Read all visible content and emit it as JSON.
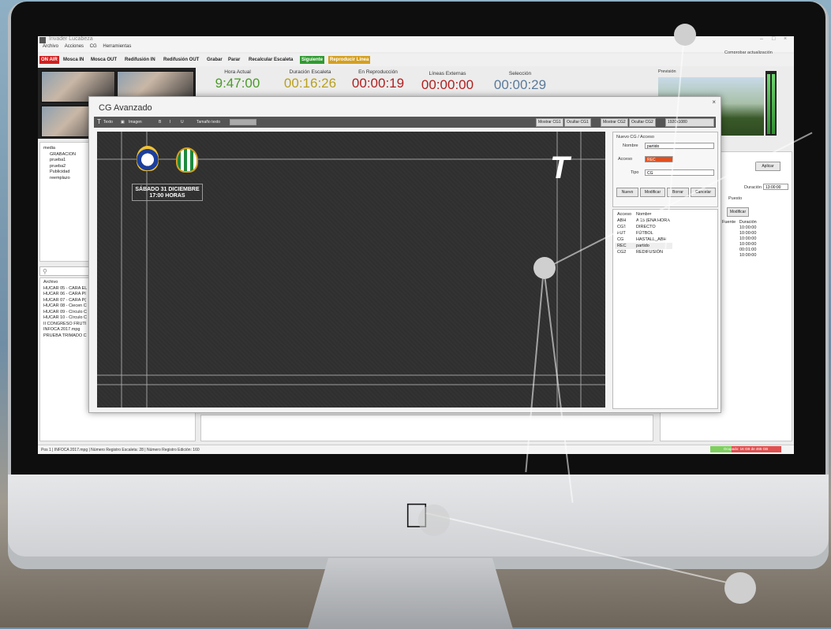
{
  "app": {
    "title": "Invader Lucabeza",
    "menu": [
      "Archivo",
      "Acciones",
      "CG",
      "Herramientas"
    ],
    "top_right_link": "Comprobar actualización"
  },
  "toolbar": {
    "on_air": "ON AIR",
    "buttons": [
      "Mosca IN",
      "Mosca OUT",
      "Redifusión IN",
      "Redifusión OUT",
      "Grabar",
      "Parar",
      "Recalcular Escaleta"
    ],
    "next_label": "Siguiente",
    "play_line_label": "Reproducir Linea"
  },
  "clocks": [
    {
      "label": "Hora Actual",
      "value": "9:47:00",
      "color": "#4a9a2a"
    },
    {
      "label": "Duración Escaleta",
      "value": "00:16:26",
      "color": "#b8a020"
    },
    {
      "label": "En Reproducción",
      "value": "00:00:19",
      "color": "#b02020"
    },
    {
      "label": "Líneas Externas",
      "value": "00:00:00",
      "color": "#b02020"
    },
    {
      "label": "Selección",
      "value": "00:00:29",
      "color": "#5a7a9a"
    }
  ],
  "preview": {
    "label": "Previsión"
  },
  "folders": [
    "media",
    "GRABACION",
    "prueba1",
    "prueba2",
    "Publicidad",
    "reemplazo"
  ],
  "files_header": "Archivo",
  "files": [
    "HUCAR 05 - CARA EL",
    "HUCAR 06 - CARA PI",
    "HUCAR 07 - CARA P(",
    "HUCAR 08 - Ciecen C",
    "HUCAR 09 - Círculo C",
    "HUCAR 10 - Círculo C",
    "II CONGRESO FRUTI",
    "INFOCA 2017.mpg",
    "PRUEBA TRIMADO C"
  ],
  "right_side": {
    "apply_label": "Aplicar",
    "duration_label": "Duración",
    "duration_value": "13:00:00",
    "position_label": "Puesto",
    "modify_label": "Modificar",
    "list_header_a": "Fuente",
    "list_header_b": "Duración",
    "durations": [
      "10:00:00",
      "10:00:00",
      "10:00:00",
      "10:00:00",
      "00:01:00",
      "10:00:00"
    ]
  },
  "cg": {
    "title": "CG Avanzado",
    "toolbar": {
      "text_label": "Texto",
      "image_label": "Imagen",
      "font_size_label": "Tamaño texto",
      "show_cg1": "Mostrar CG1",
      "hide_cg1": "Ocultar CG1",
      "show_cg2": "Mostrar CG2",
      "hide_cg2": "Ocultar CG2",
      "resolution": "1920x1080"
    },
    "canvas": {
      "date_line1": "SÁBADO 31 DICIEMBRE",
      "date_line2": "17:00 HORAS",
      "brand_mark": "T"
    },
    "panel": {
      "section_title": "Nuevo CG / Acceso",
      "name_label": "Nombre",
      "name_value": "partido",
      "shortcut_label": "Acceso",
      "shortcut_value": "REC",
      "type_label": "Tipo",
      "type_value": "CG",
      "buttons": [
        "Nuevo",
        "Modificar",
        "Borrar",
        "Cancelar"
      ],
      "table_headers": [
        "Acceso",
        "Nombre"
      ],
      "rows": [
        {
          "key": "ABH",
          "name": "A 15 (ENA HORA"
        },
        {
          "key": "CG1",
          "name": "DIRECTO"
        },
        {
          "key": "FUT",
          "name": "FÚTBOL"
        },
        {
          "key": "CG",
          "name": "HASTALL_ABH"
        },
        {
          "key": "REC",
          "name": "partido"
        },
        {
          "key": "CG2",
          "name": "REDIFUSIÓN"
        }
      ]
    }
  },
  "statusbar": {
    "text": "Pos 1  |  INFOCA 2017.mpg  |  Número Registro Escaleta: 28  |  Número Registro Edición: 160",
    "right_badge": "Ocupado: 16 GB de 465 GB"
  },
  "colors": {
    "on_air": "#d02020",
    "next": "#2f9a2f",
    "play_line": "#d4a020",
    "shortcut_value_bg": "#e05020"
  }
}
